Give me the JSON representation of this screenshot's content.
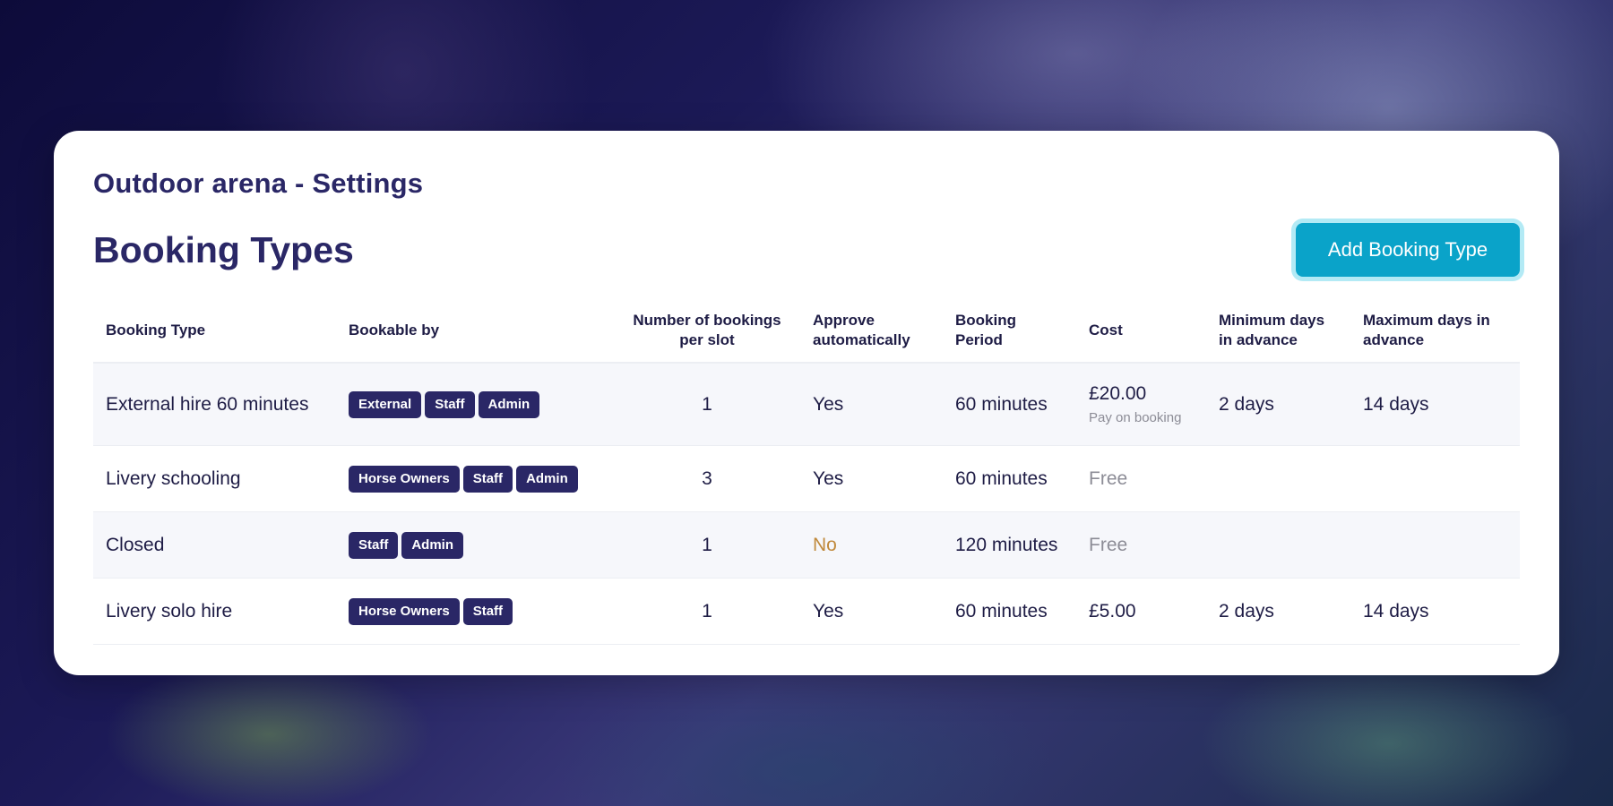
{
  "page": {
    "settings_title": "Outdoor arena - Settings",
    "section_title": "Booking Types",
    "add_button_label": "Add Booking Type"
  },
  "colors": {
    "brand_navy": "#2a2766",
    "accent_cyan": "#0aa3c9",
    "warning_no": "#c0893b"
  },
  "table": {
    "headers": {
      "booking_type": "Booking Type",
      "bookable_by": "Bookable by",
      "bookings_per_slot": "Number of bookings per slot",
      "approve_automatically": "Approve automatically",
      "booking_period": "Booking Period",
      "cost": "Cost",
      "min_days": "Minimum days in advance",
      "max_days": "Maximum days in advance"
    },
    "rows": [
      {
        "name": "External hire 60 minutes",
        "bookable_by": [
          "External",
          "Staff",
          "Admin"
        ],
        "per_slot": "1",
        "approve": "Yes",
        "period": "60 minutes",
        "cost": "£20.00",
        "cost_note": "Pay on booking",
        "min_days": "2 days",
        "max_days": "14 days"
      },
      {
        "name": "Livery schooling",
        "bookable_by": [
          "Horse Owners",
          "Staff",
          "Admin"
        ],
        "per_slot": "3",
        "approve": "Yes",
        "period": "60 minutes",
        "cost": "Free",
        "min_days": "",
        "max_days": ""
      },
      {
        "name": "Closed",
        "bookable_by": [
          "Staff",
          "Admin"
        ],
        "per_slot": "1",
        "approve": "No",
        "period": "120 minutes",
        "cost": "Free",
        "min_days": "",
        "max_days": ""
      },
      {
        "name": "Livery solo hire",
        "bookable_by": [
          "Horse Owners",
          "Staff"
        ],
        "per_slot": "1",
        "approve": "Yes",
        "period": "60 minutes",
        "cost": "£5.00",
        "min_days": "2 days",
        "max_days": "14 days"
      }
    ]
  }
}
